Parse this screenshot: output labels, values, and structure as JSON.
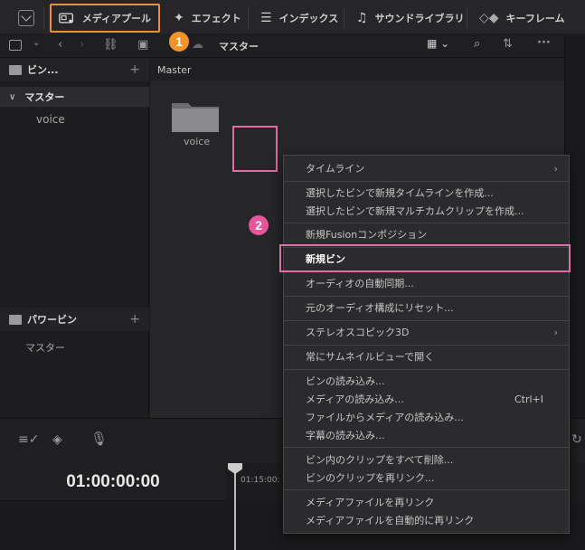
{
  "topbar": {
    "media_pool": "メディアプール",
    "effects": "エフェクト",
    "index": "インデックス",
    "sound_library": "サウンドライブラリ",
    "keyframes": "キーフレーム"
  },
  "subbar": {
    "breadcrumb": "マスター"
  },
  "sidebar": {
    "bins_header": "ビン...",
    "master_label": "マスター",
    "master_child": "voice",
    "power_bins_header": "パワービン",
    "power_bins_child": "マスター"
  },
  "main": {
    "path_label": "Master",
    "folder_label": "voice"
  },
  "timecode": "01:00:00:00",
  "ruler_time": "01:15:00:",
  "context_menu": {
    "items": [
      {
        "label": "タイムライン",
        "submenu": true
      },
      {
        "label": "選択したビンで新規タイムラインを作成..."
      },
      {
        "label": "選択したビンで新規マルチカムクリップを作成..."
      },
      {
        "label": "新規Fusionコンポジション"
      },
      {
        "label": "新規ビン"
      },
      {
        "label": "オーディオの自動同期..."
      },
      {
        "label": "元のオーディオ構成にリセット..."
      },
      {
        "label": "ステレオスコピック3D",
        "submenu": true
      },
      {
        "label": "常にサムネイルビューで開く"
      },
      {
        "label": "ビンの読み込み..."
      },
      {
        "label": "メディアの読み込み...",
        "shortcut": "Ctrl+I"
      },
      {
        "label": "ファイルからメディアの読み込み..."
      },
      {
        "label": "字幕の読み込み..."
      },
      {
        "label": "ビン内のクリップをすべて削除..."
      },
      {
        "label": "ビンのクリップを再リンク..."
      },
      {
        "label": "メディアファイルを再リンク"
      },
      {
        "label": "メディアファイルを自動的に再リンク"
      }
    ]
  },
  "annotations": {
    "badge1": "1",
    "badge2": "2"
  },
  "colors": {
    "orange_highlight": "#e8913a",
    "pink_highlight": "#e46aa8",
    "badge1": "#f0932b",
    "badge2": "#e9559b"
  }
}
